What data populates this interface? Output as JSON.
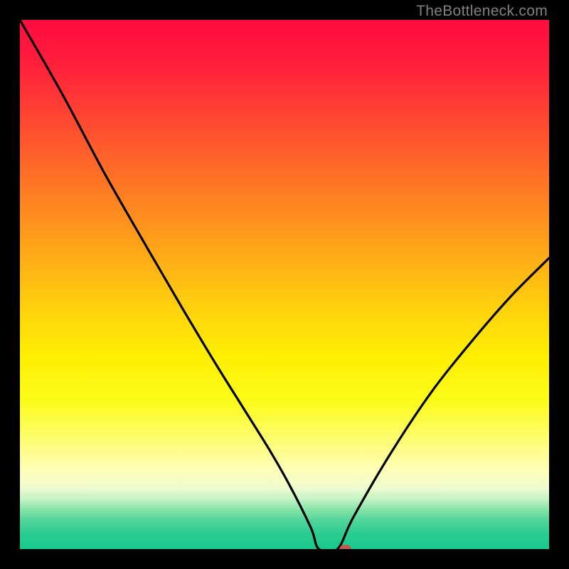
{
  "watermark": "TheBottleneck.com",
  "chart_data": {
    "type": "line",
    "title": "",
    "xlabel": "",
    "ylabel": "",
    "xlim": [
      0,
      100
    ],
    "ylim": [
      0,
      100
    ],
    "series": [
      {
        "name": "curve",
        "x": [
          0,
          8,
          16,
          24,
          31,
          37,
          42,
          47,
          51,
          55,
          56.5,
          60,
          63,
          70,
          78,
          86,
          93,
          100
        ],
        "values": [
          100,
          86,
          71,
          57,
          45,
          35,
          27,
          19,
          12,
          4,
          0,
          0,
          6,
          18,
          30,
          40,
          48,
          55
        ]
      }
    ],
    "marker": {
      "x": 61.5,
      "y": 0,
      "color": "#c05a4a"
    },
    "gradient_stops": [
      {
        "pos": 0,
        "color": "#ff0b40"
      },
      {
        "pos": 0.5,
        "color": "#ffce10"
      },
      {
        "pos": 0.8,
        "color": "#fefe90"
      },
      {
        "pos": 0.9,
        "color": "#c6f3c6"
      },
      {
        "pos": 1.0,
        "color": "#17c98e"
      }
    ]
  }
}
